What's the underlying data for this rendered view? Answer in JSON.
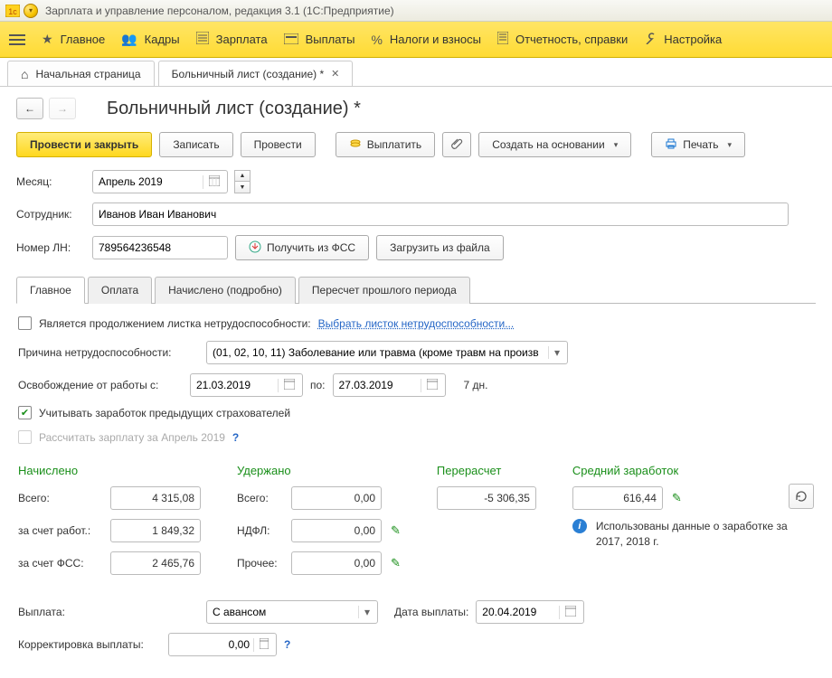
{
  "titlebar": {
    "text": "Зарплата и управление персоналом, редакция 3.1  (1С:Предприятие)"
  },
  "menu": {
    "items": [
      "Главное",
      "Кадры",
      "Зарплата",
      "Выплаты",
      "Налоги и взносы",
      "Отчетность, справки",
      "Настройка"
    ]
  },
  "tabs": {
    "home": "Начальная страница",
    "doc": "Больничный лист (создание) *"
  },
  "page_title": "Больничный лист (создание) *",
  "toolbar": {
    "post_close": "Провести и закрыть",
    "save": "Записать",
    "post": "Провести",
    "pay": "Выплатить",
    "create_from": "Создать на основании",
    "print": "Печать"
  },
  "form": {
    "month_label": "Месяц:",
    "month_value": "Апрель 2019",
    "employee_label": "Сотрудник:",
    "employee_value": "Иванов Иван Иванович",
    "ln_label": "Номер ЛН:",
    "ln_value": "789564236548",
    "get_fss": "Получить из ФСС",
    "load_file": "Загрузить из файла"
  },
  "inner_tabs": [
    "Главное",
    "Оплата",
    "Начислено (подробно)",
    "Пересчет прошлого периода"
  ],
  "glav": {
    "continuation_label": "Является продолжением листка нетрудоспособности:",
    "select_sheet_link": "Выбрать листок нетрудоспособности...",
    "reason_label": "Причина нетрудоспособности:",
    "reason_value": "(01, 02, 10, 11) Заболевание или травма (кроме травм на произв",
    "release_label": "Освобождение от работы с:",
    "date_from": "21.03.2019",
    "po_label": "по:",
    "date_to": "27.03.2019",
    "days_text": "7 дн.",
    "consider_prev": "Учитывать заработок предыдущих страхователей",
    "recalc_label": "Рассчитать зарплату за Апрель 2019"
  },
  "summary": {
    "accrued_hd": "Начислено",
    "withheld_hd": "Удержано",
    "recalc_hd": "Перерасчет",
    "avg_hd": "Средний заработок",
    "total_lbl": "Всего:",
    "total_val": "4 315,08",
    "employer_lbl": "за счет работ.:",
    "employer_val": "1 849,32",
    "fss_lbl": "за счет ФСС:",
    "fss_val": "2 465,76",
    "withheld_total": "0,00",
    "ndfl_lbl": "НДФЛ:",
    "ndfl_val": "0,00",
    "other_lbl": "Прочее:",
    "other_val": "0,00",
    "recalc_val": "-5 306,35",
    "avg_val": "616,44",
    "info_text": "Использованы данные о заработке за 2017,  2018 г."
  },
  "payout": {
    "label": "Выплата:",
    "mode": "С авансом",
    "date_label": "Дата выплаты:",
    "date_value": "20.04.2019",
    "correction_label": "Корректировка выплаты:",
    "correction_value": "0,00"
  }
}
